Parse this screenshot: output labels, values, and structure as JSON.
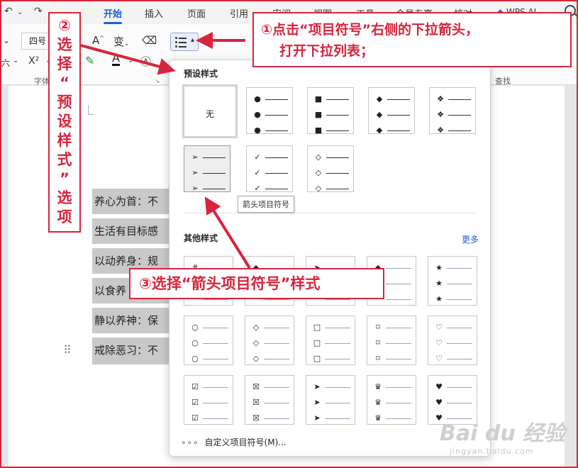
{
  "ribbon": {
    "tabs": [
      "开始",
      "插入",
      "页面",
      "引用",
      "审阅",
      "视图",
      "工具",
      "会员专享",
      "校对"
    ],
    "active_tab": "开始",
    "wps_ai": "WPS AI",
    "font_size": "四号",
    "group_font": "字体",
    "group_find": "查找",
    "tools": {
      "grow_font": "A",
      "phonetic": "变",
      "superscript": "X²",
      "six": "六"
    }
  },
  "document": {
    "lines": [
      "养心为首：不",
      "生活有目标感",
      "以动养身：规",
      "以食养",
      "静以养神：保",
      "戒除恶习：不"
    ]
  },
  "panel": {
    "preset_title": "预设样式",
    "none_label": "无",
    "preset_glyphs": [
      [
        "",
        "",
        ""
      ],
      [
        "●",
        "●",
        "●"
      ],
      [
        "■",
        "■",
        "■"
      ],
      [
        "◆",
        "◆",
        "◆"
      ],
      [
        "❖",
        "❖",
        "❖"
      ],
      [
        "➢",
        "➢",
        "➢"
      ],
      [
        "✓",
        "✓",
        "✓"
      ],
      [
        "◇",
        "◇",
        "◇"
      ]
    ],
    "tooltip": "箭头项目符号",
    "other_title": "其他样式",
    "more_label": "更多",
    "other_glyphs": [
      [
        "#",
        "",
        ""
      ],
      [
        "◆",
        "",
        ""
      ],
      [
        "➤",
        "",
        ""
      ],
      [
        "◆",
        "",
        ""
      ],
      [
        "★",
        "★",
        "★"
      ],
      [
        "○",
        "○",
        "○"
      ],
      [
        "◇",
        "◇",
        "◇"
      ],
      [
        "□",
        "□",
        "□"
      ],
      [
        "⌑",
        "⌑",
        "⌑"
      ],
      [
        "♡",
        "♡",
        "♡"
      ],
      [
        "☑",
        "☑",
        "☑"
      ],
      [
        "☒",
        "☒",
        "☒"
      ],
      [
        "➤",
        "➤",
        "➤"
      ],
      [
        "♛",
        "♛",
        "♛"
      ],
      [
        "♥",
        "♥",
        "♥"
      ]
    ],
    "custom_label": "自定义项目符号(M)...",
    "custom_dots": "∘∘∘"
  },
  "annotations": {
    "step1_line1": "①点击“项目符号”右侧的下拉箭头，",
    "step1_line2": "打开下拉列表；",
    "step2_chars": [
      "②",
      "选",
      "择",
      "“",
      "预",
      "设",
      "样",
      "式",
      "”",
      "选",
      "项"
    ],
    "step3": "③选择“箭头项目符号”样式",
    "color": "#d8243c"
  },
  "watermark": {
    "logo": "Bai du 经验",
    "url": "jingyan.baidu.com"
  }
}
